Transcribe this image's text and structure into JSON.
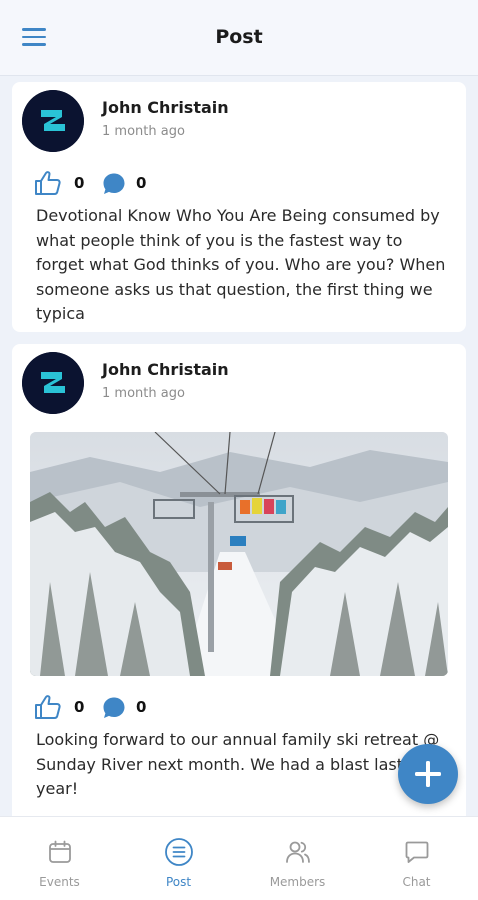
{
  "header": {
    "title": "Post"
  },
  "posts": [
    {
      "author": "John Christain",
      "time": "1 month ago",
      "likes": "0",
      "comments": "0",
      "text": "Devotional Know Who You Are Being consumed by what people think of you is the fastest way to forget what God thinks of you. Who are you? When someone asks us that question, the first thing we typica"
    },
    {
      "author": "John Christain",
      "time": "1 month ago",
      "likes": "0",
      "comments": "0",
      "text": "Looking forward to our annual family ski retreat @ Sunday River next month.  We had a blast last year!"
    }
  ],
  "nav": {
    "items": [
      {
        "label": "Events",
        "icon": "calendar-icon"
      },
      {
        "label": "Post",
        "icon": "post-icon"
      },
      {
        "label": "Members",
        "icon": "members-icon"
      },
      {
        "label": "Chat",
        "icon": "chat-icon"
      }
    ],
    "active": "Post"
  },
  "colors": {
    "accent": "#3f86c6",
    "background": "#eef2f9",
    "inactive": "#9a9a9a"
  }
}
